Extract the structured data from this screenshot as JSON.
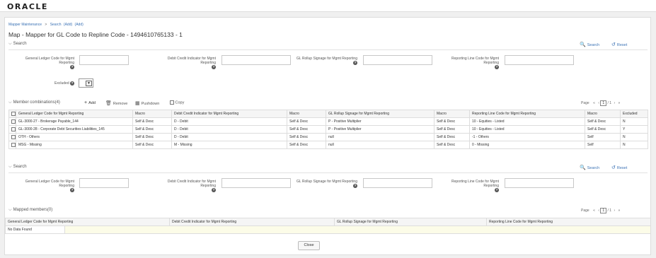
{
  "app": {
    "logo": "ORACLE"
  },
  "breadcrumb": {
    "items": [
      "Mapper Maintenance",
      "Search",
      "(Add)",
      "(Add)"
    ],
    "sep": ">"
  },
  "page": {
    "title": "Map - Mapper for GL Code to Repline Code - 1494610765133 - 1"
  },
  "search1": {
    "header": "Search",
    "search_label": "Search",
    "reset_label": "Reset",
    "fields": [
      "General Ledger Code for Mgmt Reporting",
      "Debit Credit Indicator for Mgmt Reporting",
      "GL Rollup Signage for Mgmt Reporting",
      "Reporting Line Code for Mgmt Reporting"
    ],
    "excluded_label": "Excluded",
    "help_glyph": "?"
  },
  "members": {
    "header": "Member combinations(4)",
    "add_label": "Add",
    "remove_label": "Remove",
    "pushdown_label": "Pushdown",
    "copy_label": "Copy",
    "pager": {
      "label": "Page",
      "current": "1",
      "total": "/ 1"
    },
    "columns": [
      "General Ledger Code for Mgmt Reporting",
      "Macro",
      "Debit Credit Indicator for Mgmt Reporting",
      "Macro",
      "GL Rollup Signage for Mgmt Reporting",
      "Macro",
      "Reporting Line Code for Mgmt Reporting",
      "Macro",
      "Excluded"
    ],
    "rows": [
      [
        "GL-3000-27 - Brokerage Payable_144",
        "Self & Desc",
        "D - Debit",
        "Self & Desc",
        "P - Positive Multiplier",
        "Self & Desc",
        "10 - Equities - Listed",
        "Self & Desc",
        "N"
      ],
      [
        "GL-3000-28 - Corporate Debt Securities Liabilities_145",
        "Self & Desc",
        "D - Debit",
        "Self & Desc",
        "P - Positive Multiplier",
        "Self & Desc",
        "10 - Equities - Listed",
        "Self & Desc",
        "Y"
      ],
      [
        "OTH - Others",
        "Self & Desc",
        "D - Debit",
        "Self & Desc",
        "null",
        "Self & Desc",
        "-1 - Others",
        "Self",
        "N"
      ],
      [
        "MSG - Missing",
        "Self & Desc",
        "M - Missing",
        "Self & Desc",
        "null",
        "Self & Desc",
        "0 - Missing",
        "Self",
        "N"
      ]
    ]
  },
  "search2": {
    "header": "Search",
    "search_label": "Search",
    "reset_label": "Reset",
    "fields": [
      "General Ledger Code for Mgmt Reporting",
      "Debit Credit Indicator for Mgmt Reporting",
      "GL Rollup Signage for Mgmt Reporting",
      "Reporting Line Code for Mgmt Reporting"
    ]
  },
  "mapped": {
    "header": "Mapped members(0)",
    "pager": {
      "label": "Page",
      "current": "1",
      "total": "/ 1"
    },
    "columns": [
      "General Ledger Code for Mgmt Reporting",
      "Debit Credit Indicator for Mgmt Reporting",
      "GL Rollup Signage for Mgmt Reporting",
      "Reporting Line Code for Mgmt Reporting"
    ],
    "empty_text": "No Data Found"
  },
  "footer": {
    "close_label": "Close"
  },
  "icons": {
    "chevron": "⌵",
    "search": "🔍",
    "reset": "↺",
    "plus": "+",
    "trash": "🗑",
    "pushdown": "▦",
    "pager_first": "«",
    "pager_prev": "‹",
    "pager_next": "›",
    "pager_last": "»"
  },
  "colors": {
    "link": "#3b72b5",
    "panel_bg": "#f0f0f0",
    "nodata_bg": "#fcfce8"
  }
}
